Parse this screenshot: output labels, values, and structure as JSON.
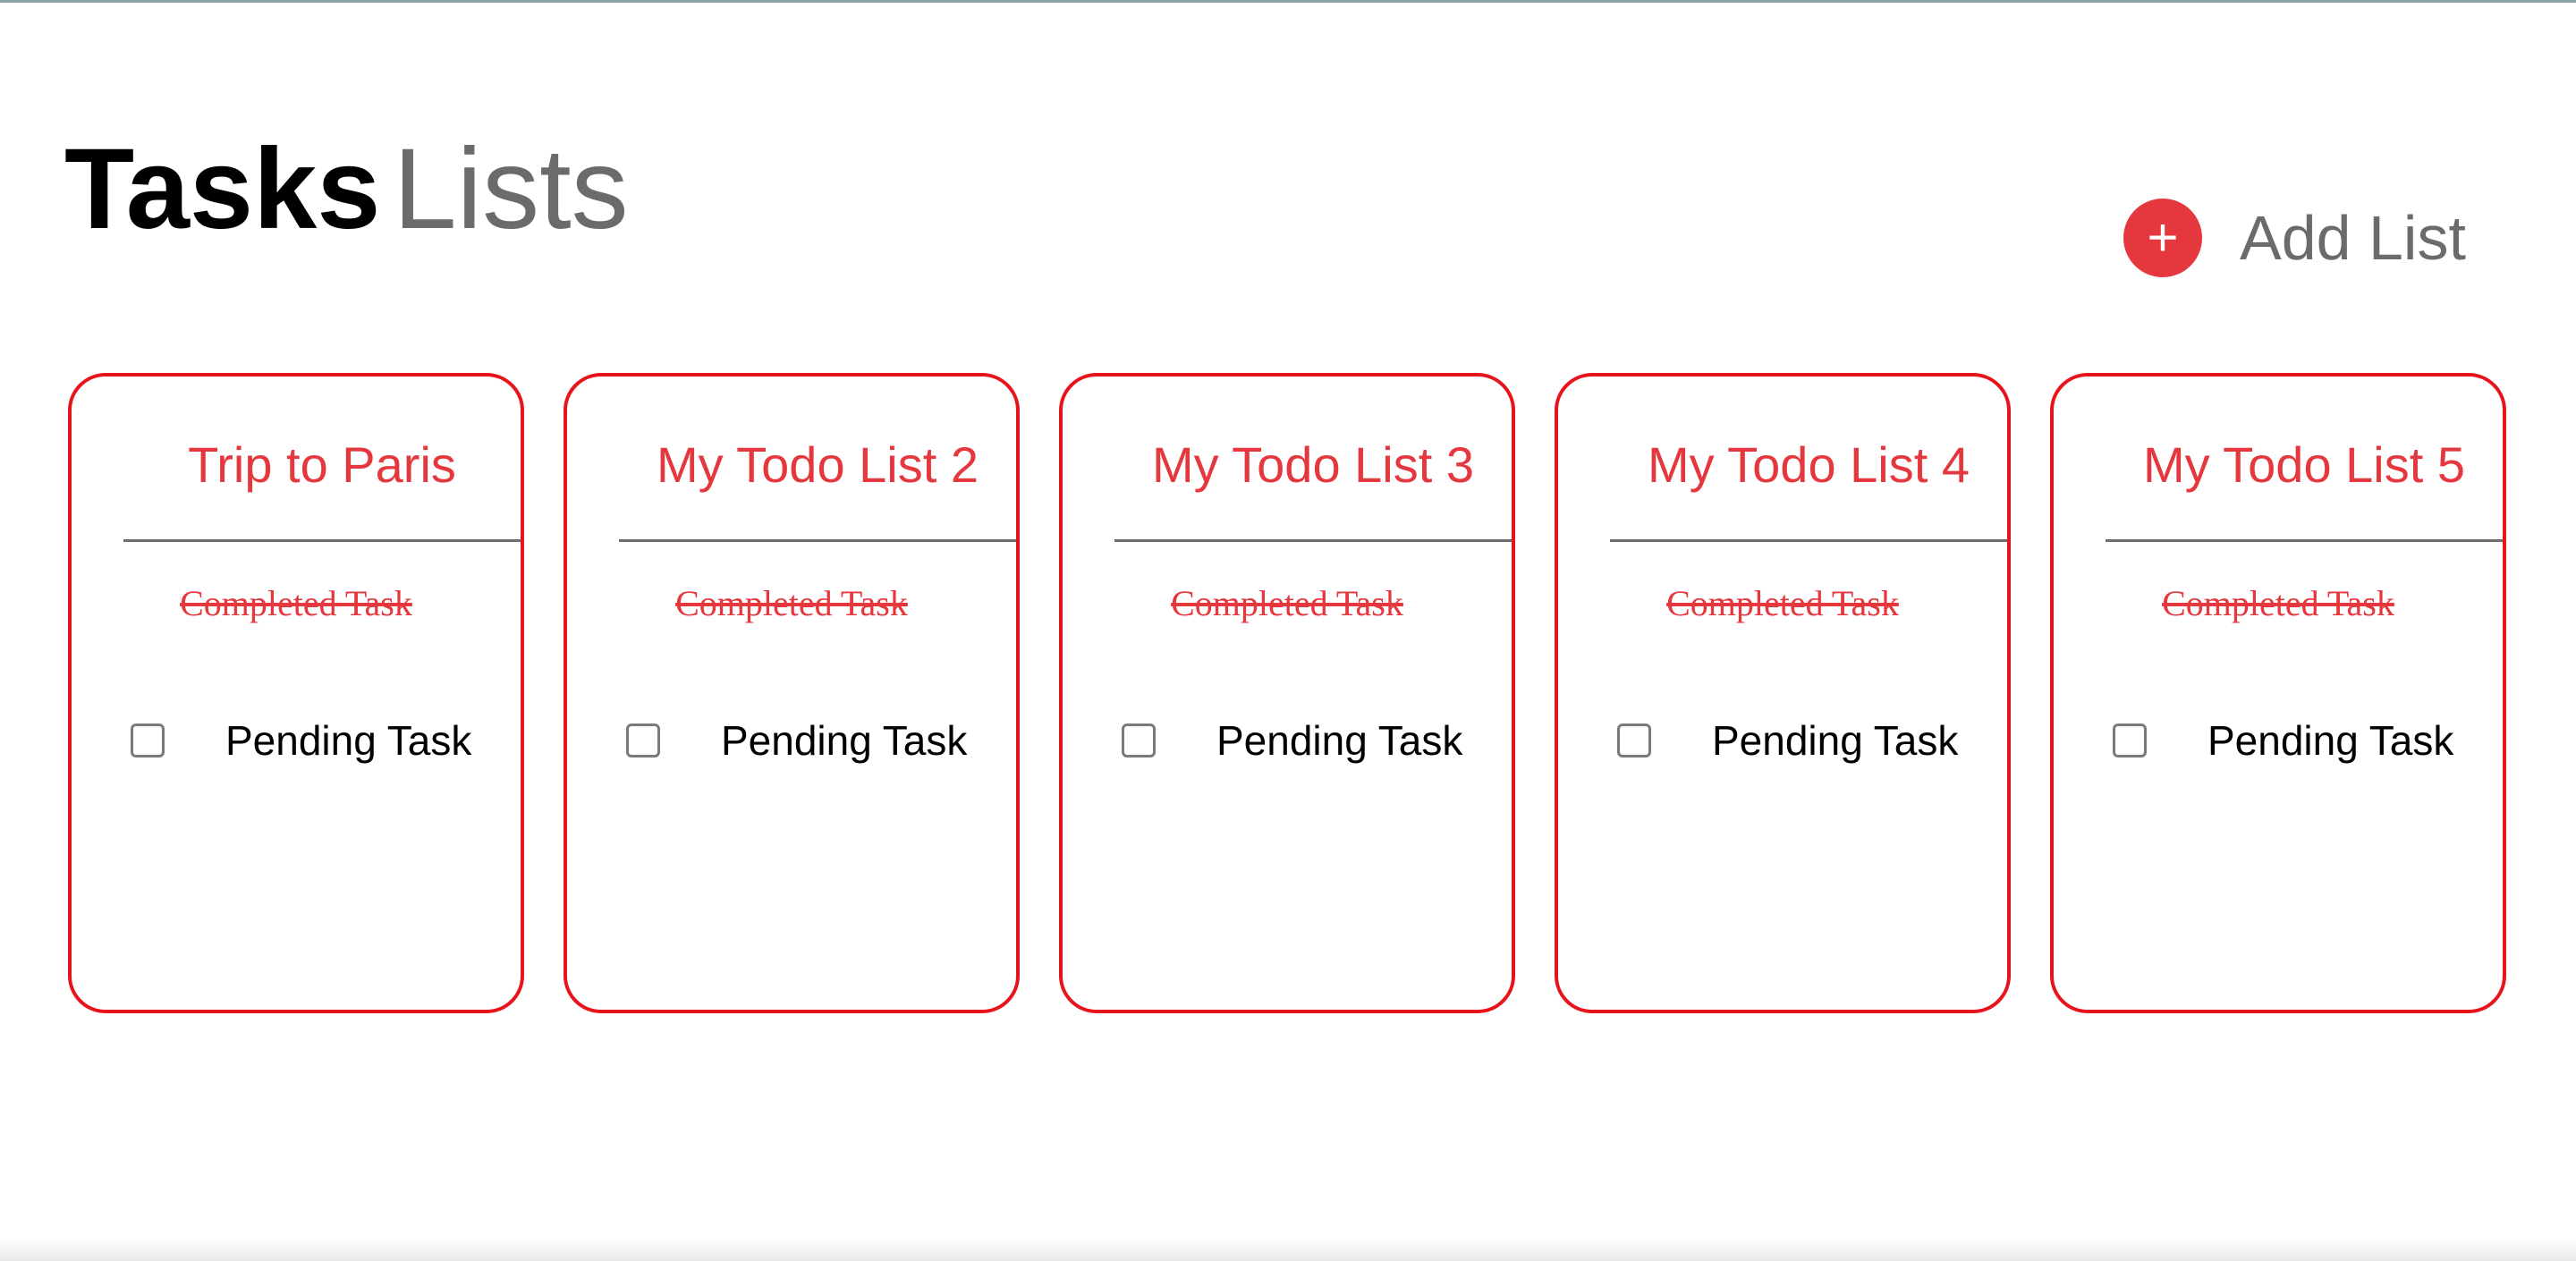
{
  "header": {
    "title_bold": "Tasks",
    "title_light": "Lists"
  },
  "add_list": {
    "icon": "+",
    "label": "Add List"
  },
  "lists": [
    {
      "title": "Trip to Paris",
      "completed_task": "Completed Task",
      "pending_task": "Pending Task"
    },
    {
      "title": "My Todo List 2",
      "completed_task": "Completed Task",
      "pending_task": "Pending Task"
    },
    {
      "title": "My Todo List 3",
      "completed_task": "Completed Task",
      "pending_task": "Pending Task"
    },
    {
      "title": "My Todo List 4",
      "completed_task": "Completed Task",
      "pending_task": "Pending Task"
    },
    {
      "title": "My Todo List 5",
      "completed_task": "Completed Task",
      "pending_task": "Pending Task"
    }
  ],
  "colors": {
    "accent": "#e5383e",
    "card_border": "#e8141c",
    "muted_text": "#6b6b6b"
  }
}
